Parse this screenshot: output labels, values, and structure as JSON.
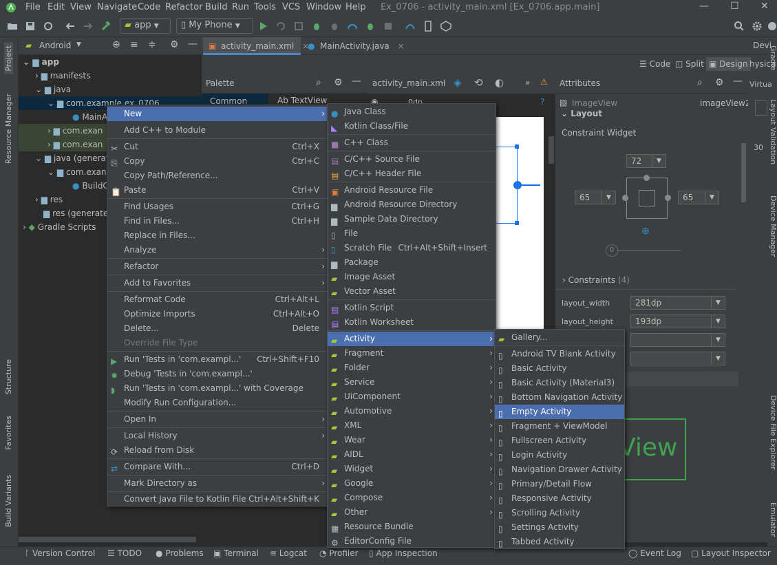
{
  "title_bar": {
    "menus": [
      "File",
      "Edit",
      "View",
      "Navigate",
      "Code",
      "Refactor",
      "Build",
      "Run",
      "Tools",
      "VCS",
      "Window",
      "Help"
    ],
    "window_title": "Ex_0706 - activity_main.xml [Ex_0706.app.main]"
  },
  "toolbar": {
    "module": "app",
    "device": "My Phone"
  },
  "project": {
    "view": "Android",
    "tree": [
      "app",
      "manifests",
      "java",
      "com.example.ex_0706",
      "MainA",
      "com.exan",
      "com.exan",
      "java (generate",
      "com.exan",
      "BuildC",
      "res",
      "res (generate",
      "Gradle Scripts"
    ]
  },
  "left_strip": [
    "Project",
    "Resource Manager",
    "Structure",
    "Favorites",
    "Build Variants"
  ],
  "right_strip": [
    "Gradle",
    "Layout Validation",
    "Device Manager",
    "Device File Explorer",
    "Emulator"
  ],
  "editor": {
    "tabs": [
      "activity_main.xml",
      "MainActivity.java"
    ],
    "modes": [
      "Code",
      "Split",
      "Design"
    ],
    "palette_title": "Palette",
    "palette_common": "Common",
    "palette_textview": "Ab TextView",
    "file_combo": "activity_main.xml",
    "dp_label": "0dp",
    "preview_text": "View",
    "device_label": "Devi",
    "right_frag": [
      "hysica",
      "Virtua",
      "30"
    ]
  },
  "attributes": {
    "title": "Attributes",
    "component": "ImageView",
    "id": "imageView2",
    "layout_section": "Layout",
    "constraint_widget": "Constraint Widget",
    "margin_top": "72",
    "margin_left": "65",
    "margin_right": "65",
    "bias": "0",
    "constraints": "Constraints",
    "constraints_count": "(4)",
    "layout_width_label": "layout_width",
    "layout_width": "281dp",
    "layout_height_label": "layout_height",
    "layout_height": "193dp"
  },
  "context_menu": [
    {
      "label": "New",
      "arrow": true,
      "selected": true
    },
    {
      "label": "Add C++ to Module"
    },
    {
      "label": "Cut",
      "shortcut": "Ctrl+X"
    },
    {
      "label": "Copy",
      "shortcut": "Ctrl+C"
    },
    {
      "label": "Copy Path/Reference..."
    },
    {
      "label": "Paste",
      "shortcut": "Ctrl+V"
    },
    {
      "label": "Find Usages",
      "shortcut": "Ctrl+G"
    },
    {
      "label": "Find in Files...",
      "shortcut": "Ctrl+H"
    },
    {
      "label": "Replace in Files..."
    },
    {
      "label": "Analyze",
      "arrow": true
    },
    {
      "label": "Refactor",
      "arrow": true
    },
    {
      "label": "Add to Favorites",
      "arrow": true
    },
    {
      "label": "Reformat Code",
      "shortcut": "Ctrl+Alt+L"
    },
    {
      "label": "Optimize Imports",
      "shortcut": "Ctrl+Alt+O"
    },
    {
      "label": "Delete...",
      "shortcut": "Delete"
    },
    {
      "label": "Override File Type",
      "disabled": true
    },
    {
      "label": "Run 'Tests in 'com.exampl...'",
      "shortcut": "Ctrl+Shift+F10"
    },
    {
      "label": "Debug 'Tests in 'com.exampl...'"
    },
    {
      "label": "Run 'Tests in 'com.exampl...' with Coverage"
    },
    {
      "label": "Modify Run Configuration..."
    },
    {
      "label": "Open In",
      "arrow": true
    },
    {
      "label": "Local History",
      "arrow": true
    },
    {
      "label": "Reload from Disk"
    },
    {
      "label": "Compare With...",
      "shortcut": "Ctrl+D"
    },
    {
      "label": "Mark Directory as",
      "arrow": true
    },
    {
      "label": "Convert Java File to Kotlin File",
      "shortcut": "Ctrl+Alt+Shift+K"
    }
  ],
  "new_menu": [
    {
      "label": "Java Class"
    },
    {
      "label": "Kotlin Class/File"
    },
    {
      "label": "C++ Class"
    },
    {
      "label": "C/C++ Source File"
    },
    {
      "label": "C/C++ Header File"
    },
    {
      "label": "Android Resource File"
    },
    {
      "label": "Android Resource Directory"
    },
    {
      "label": "Sample Data Directory"
    },
    {
      "label": "File"
    },
    {
      "label": "Scratch File",
      "shortcut": "Ctrl+Alt+Shift+Insert"
    },
    {
      "label": "Package"
    },
    {
      "label": "Image Asset"
    },
    {
      "label": "Vector Asset"
    },
    {
      "label": "Kotlin Script"
    },
    {
      "label": "Kotlin Worksheet"
    },
    {
      "label": "Activity",
      "arrow": true,
      "selected": true
    },
    {
      "label": "Fragment",
      "arrow": true
    },
    {
      "label": "Folder",
      "arrow": true
    },
    {
      "label": "Service",
      "arrow": true
    },
    {
      "label": "UiComponent",
      "arrow": true
    },
    {
      "label": "Automotive",
      "arrow": true
    },
    {
      "label": "XML",
      "arrow": true
    },
    {
      "label": "Wear",
      "arrow": true
    },
    {
      "label": "AIDL",
      "arrow": true
    },
    {
      "label": "Widget",
      "arrow": true
    },
    {
      "label": "Google",
      "arrow": true
    },
    {
      "label": "Compose",
      "arrow": true
    },
    {
      "label": "Other",
      "arrow": true
    },
    {
      "label": "Resource Bundle"
    },
    {
      "label": "EditorConfig File"
    }
  ],
  "activity_menu": [
    {
      "label": "Gallery..."
    },
    {
      "label": "Android TV Blank Activity"
    },
    {
      "label": "Basic Activity"
    },
    {
      "label": "Basic Activity (Material3)"
    },
    {
      "label": "Bottom Navigation Activity"
    },
    {
      "label": "Empty Activity",
      "selected": true
    },
    {
      "label": "Fragment + ViewModel"
    },
    {
      "label": "Fullscreen Activity"
    },
    {
      "label": "Login Activity"
    },
    {
      "label": "Navigation Drawer Activity"
    },
    {
      "label": "Primary/Detail Flow"
    },
    {
      "label": "Responsive Activity"
    },
    {
      "label": "Scrolling Activity"
    },
    {
      "label": "Settings Activity"
    },
    {
      "label": "Tabbed Activity"
    }
  ],
  "bottom_bar": [
    "Version Control",
    "TODO",
    "Problems",
    "Terminal",
    "Logcat",
    "Profiler",
    "App Inspection",
    "Event Log",
    "Layout Inspector"
  ],
  "colors": {
    "accent": "#4b6eaf",
    "android_green": "#a4c639",
    "blue": "#3592c4"
  }
}
